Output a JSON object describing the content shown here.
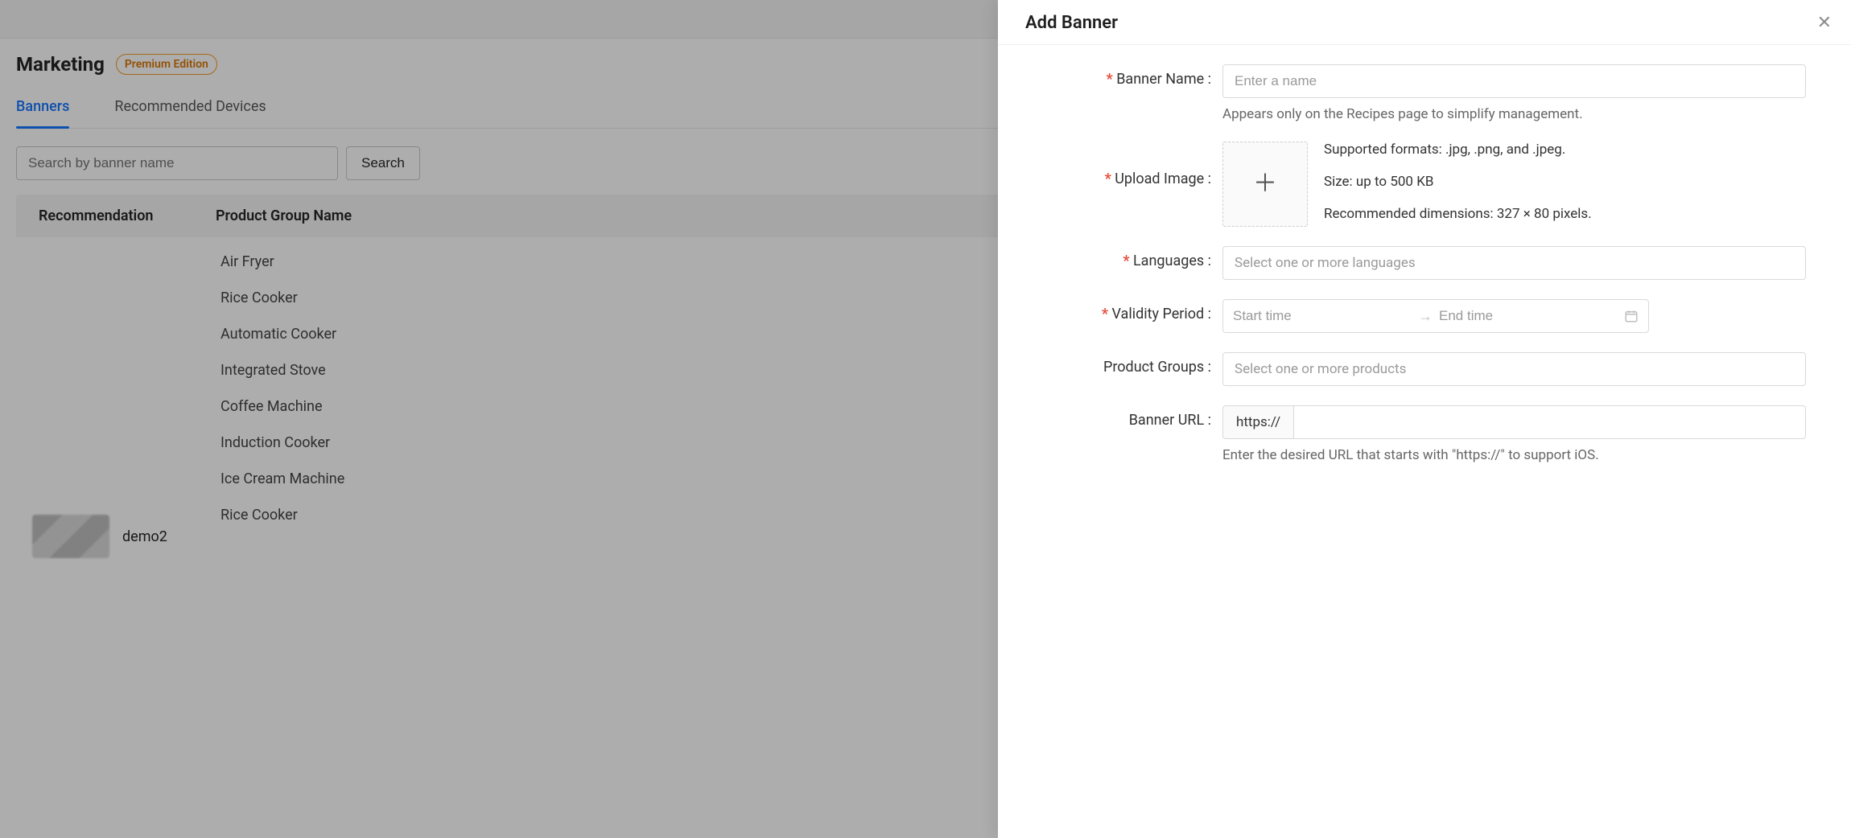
{
  "page": {
    "title": "Marketing",
    "badge": "Premium Edition",
    "tabs": [
      {
        "label": "Banners",
        "active": true
      },
      {
        "label": "Recommended Devices",
        "active": false
      }
    ],
    "search": {
      "placeholder": "Search by banner name",
      "button": "Search"
    },
    "table": {
      "headers": {
        "recommendation": "Recommendation",
        "product_group_name": "Product Group Name"
      },
      "product_groups": [
        "Air Fryer",
        "Rice Cooker",
        "Automatic Cooker",
        "Integrated Stove",
        "Coffee Machine",
        "Induction Cooker",
        "Ice Cream Machine",
        "Rice Cooker"
      ],
      "demo_label": "demo2"
    }
  },
  "drawer": {
    "title": "Add Banner",
    "close_aria": "Close",
    "fields": {
      "banner_name": {
        "label": "Banner Name :",
        "placeholder": "Enter a name",
        "help": "Appears only on the Recipes page to simplify management."
      },
      "upload_image": {
        "label": "Upload Image :",
        "formats": "Supported formats: .jpg, .png, and .jpeg.",
        "size": "Size: up to 500 KB",
        "dimensions": "Recommended dimensions: 327 × 80 pixels."
      },
      "languages": {
        "label": "Languages :",
        "placeholder": "Select one or more languages"
      },
      "validity": {
        "label": "Validity Period :",
        "start_placeholder": "Start time",
        "end_placeholder": "End time"
      },
      "product_groups": {
        "label": "Product Groups :",
        "placeholder": "Select one or more products"
      },
      "banner_url": {
        "label": "Banner URL :",
        "addon": "https://",
        "help": "Enter the desired URL that starts with \"https://\" to support iOS."
      }
    }
  }
}
